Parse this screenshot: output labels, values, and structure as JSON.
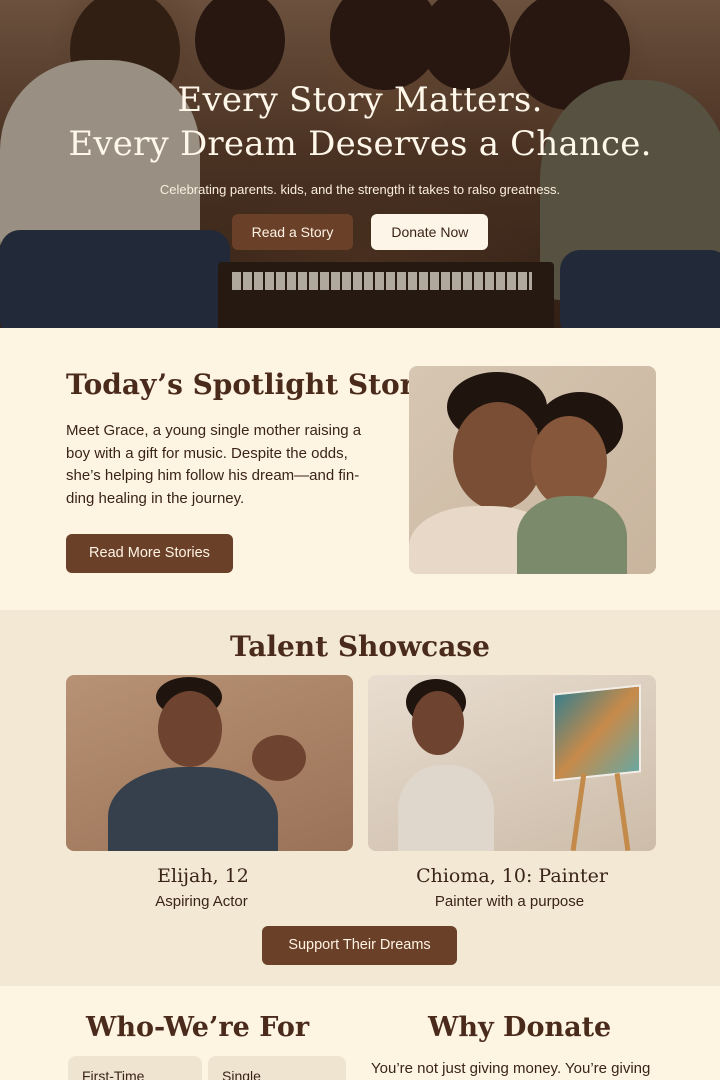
{
  "hero": {
    "title_line1": "Every Story Matters.",
    "title_line2": "Every Dream Deserves a Chance.",
    "subtitle": "Celebrating parents. kids, and the strength it takes to ralso greatness.",
    "read_story_label": "Read a Story",
    "donate_label": "Donate Now"
  },
  "spotlight": {
    "title": "Today’s Spotlight Story",
    "text": "Meet Grace, a young single mother raising a boy with a gift for music. Despite the odds, she’s helping him follow his dream—and fin-ding healing in the journey.",
    "button_label": "Read More Stories"
  },
  "talent": {
    "title": "Talent Showcase",
    "cards": [
      {
        "name": "Elijah, 12",
        "description": "Aspiring Actor"
      },
      {
        "name": "Chioma, 10: Painter",
        "description": "Painter with a purpose"
      }
    ],
    "button_label": "Support Their Dreams"
  },
  "who": {
    "title": "Who-We’re For",
    "pills": [
      "First-Time",
      "Single"
    ]
  },
  "why": {
    "title": "Why Donate",
    "text": "You’re not just giving money. You’re giving"
  },
  "colors": {
    "brand_brown": "#6a4028",
    "cream": "#fdf5e2",
    "heading": "#4a2a1a"
  }
}
